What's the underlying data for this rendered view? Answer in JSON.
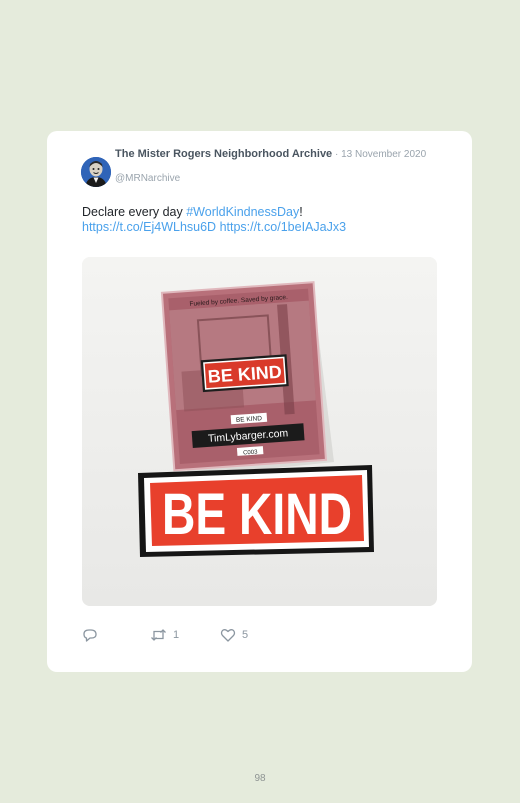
{
  "tweet": {
    "display_name": "The Mister Rogers Neighborhood Archive",
    "separator": " · ",
    "date": "13 November 2020",
    "handle": "@MRNarchive",
    "text_plain": "Declare every day ",
    "hashtag": "#WorldKindnessDay",
    "text_after_hashtag": "!",
    "link1": "https://t.co/Ej4WLhsu6D",
    "link2": "https://t.co/1beIAJaJx3",
    "photo": {
      "package_tagline": "Fueled by coffee. Saved by grace.",
      "pin_text": "BE KIND",
      "card_label": "BE KIND",
      "card_site": "TimLybarger.com",
      "card_code": "C003",
      "sticker_text": "BE KIND"
    },
    "reply_count": "",
    "retweet_count": "1",
    "like_count": "5",
    "accent_color": "#4aa1eb",
    "icons": {
      "reply": "reply-icon",
      "retweet": "retweet-icon",
      "like": "heart-icon"
    }
  },
  "page": {
    "number": "98"
  }
}
